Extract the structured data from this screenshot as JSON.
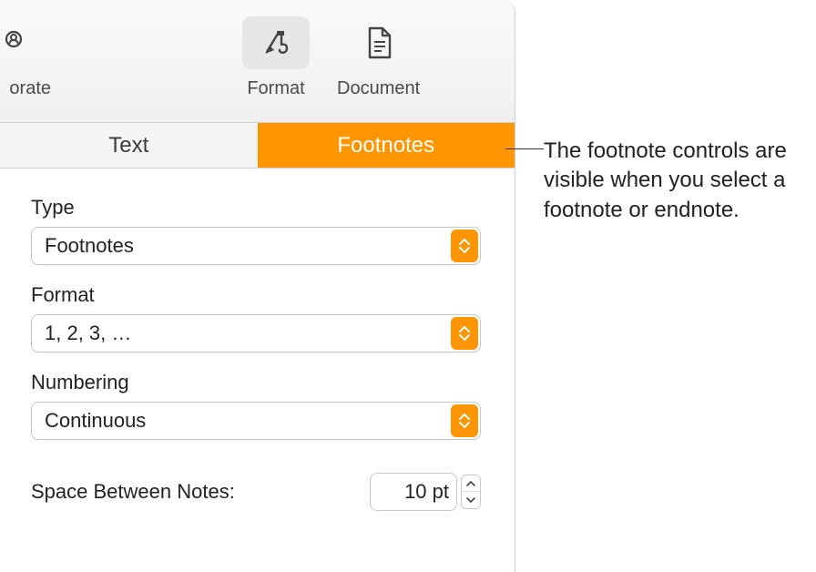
{
  "toolbar": {
    "partial_label": "orate",
    "format_label": "Format",
    "document_label": "Document"
  },
  "tabs": {
    "text_label": "Text",
    "footnotes_label": "Footnotes"
  },
  "fields": {
    "type": {
      "label": "Type",
      "value": "Footnotes"
    },
    "format": {
      "label": "Format",
      "value": "1, 2, 3, …"
    },
    "numbering": {
      "label": "Numbering",
      "value": "Continuous"
    },
    "space": {
      "label": "Space Between Notes:",
      "value": "10 pt"
    }
  },
  "callout": "The footnote controls are visible when you select a footnote or endnote."
}
